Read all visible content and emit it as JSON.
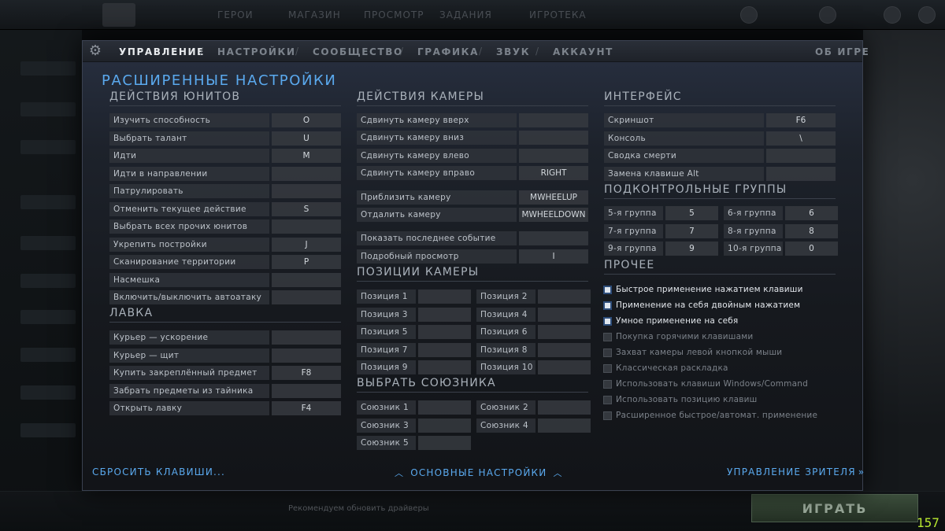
{
  "background": {
    "nav_items": [
      "ГЕРОИ",
      "МАГАЗИН",
      "ПРОСМОТР",
      "ЗАДАНИЯ",
      "ИГРОТЕКА"
    ],
    "play_label": "ИГРАТЬ",
    "chat_text": "Рекомендуем обновить драйверы",
    "fps": "157"
  },
  "tabs": [
    {
      "label": "УПРАВЛЕНИЕ",
      "active": true
    },
    {
      "label": "НАСТРОЙКИ",
      "active": false
    },
    {
      "label": "СООБЩЕСТВО",
      "active": false
    },
    {
      "label": "ГРАФИКА",
      "active": false
    },
    {
      "label": "ЗВУК",
      "active": false
    },
    {
      "label": "АККАУНТ",
      "active": false
    }
  ],
  "tab_separator": "/",
  "about_label": "ОБ ИГРЕ",
  "page_title": "РАСШИРЕННЫЕ НАСТРОЙКИ",
  "unit_actions": {
    "title": "ДЕЙСТВИЯ ЮНИТОВ",
    "rows": [
      {
        "label": "Изучить способность",
        "key": "O"
      },
      {
        "label": "Выбрать талант",
        "key": "U"
      },
      {
        "label": "Идти",
        "key": "M"
      },
      {
        "label": "Идти в направлении",
        "key": ""
      },
      {
        "label": "Патрулировать",
        "key": ""
      },
      {
        "label": "Отменить текущее действие",
        "key": "S"
      },
      {
        "label": "Выбрать всех прочих юнитов",
        "key": ""
      },
      {
        "label": "Укрепить постройки",
        "key": "J"
      },
      {
        "label": "Сканирование территории",
        "key": "P"
      },
      {
        "label": "Насмешка",
        "key": ""
      },
      {
        "label": "Включить/выключить автоатаку",
        "key": ""
      }
    ]
  },
  "shop": {
    "title": "ЛАВКА",
    "rows": [
      {
        "label": "Курьер — ускорение",
        "key": ""
      },
      {
        "label": "Курьер — щит",
        "key": ""
      },
      {
        "label": "Купить закреплённый предмет",
        "key": "F8"
      },
      {
        "label": "Забрать предметы из тайника",
        "key": ""
      },
      {
        "label": "Открыть лавку",
        "key": "F4"
      }
    ]
  },
  "camera_actions": {
    "title": "ДЕЙСТВИЯ КАМЕРЫ",
    "rows": [
      {
        "label": "Сдвинуть камеру вверх",
        "key": ""
      },
      {
        "label": "Сдвинуть камеру вниз",
        "key": ""
      },
      {
        "label": "Сдвинуть камеру влево",
        "key": ""
      },
      {
        "label": "Сдвинуть камеру вправо",
        "key": "RIGHT"
      },
      {
        "label": "Приблизить камеру",
        "key": "MWHEELUP"
      },
      {
        "label": "Отдалить камеру",
        "key": "MWHEELDOWN"
      },
      {
        "label": "Показать последнее событие",
        "key": ""
      },
      {
        "label": "Подробный просмотр",
        "key": "I"
      }
    ]
  },
  "camera_positions": {
    "title": "ПОЗИЦИИ КАМЕРЫ",
    "items": [
      {
        "label": "Позиция 1",
        "key": ""
      },
      {
        "label": "Позиция 2",
        "key": ""
      },
      {
        "label": "Позиция 3",
        "key": ""
      },
      {
        "label": "Позиция 4",
        "key": ""
      },
      {
        "label": "Позиция 5",
        "key": ""
      },
      {
        "label": "Позиция 6",
        "key": ""
      },
      {
        "label": "Позиция 7",
        "key": ""
      },
      {
        "label": "Позиция 8",
        "key": ""
      },
      {
        "label": "Позиция 9",
        "key": ""
      },
      {
        "label": "Позиция 10",
        "key": ""
      }
    ]
  },
  "select_ally": {
    "title": "ВЫБРАТЬ СОЮЗНИКА",
    "items": [
      {
        "label": "Союзник 1",
        "key": ""
      },
      {
        "label": "Союзник 2",
        "key": ""
      },
      {
        "label": "Союзник 3",
        "key": ""
      },
      {
        "label": "Союзник 4",
        "key": ""
      },
      {
        "label": "Союзник 5",
        "key": ""
      }
    ]
  },
  "interface": {
    "title": "ИНТЕРФЕЙС",
    "rows": [
      {
        "label": "Скриншот",
        "key": "F6"
      },
      {
        "label": "Консоль",
        "key": "\\"
      },
      {
        "label": "Сводка смерти",
        "key": ""
      },
      {
        "label": "Замена клавише Alt",
        "key": ""
      }
    ]
  },
  "control_groups": {
    "title": "ПОДКОНТРОЛЬНЫЕ ГРУППЫ",
    "items": [
      {
        "label": "5-я группа",
        "key": "5"
      },
      {
        "label": "6-я группа",
        "key": "6"
      },
      {
        "label": "7-я группа",
        "key": "7"
      },
      {
        "label": "8-я группа",
        "key": "8"
      },
      {
        "label": "9-я группа",
        "key": "9"
      },
      {
        "label": "10-я группа",
        "key": "0"
      }
    ]
  },
  "other": {
    "title": "ПРОЧЕЕ",
    "options": [
      {
        "label": "Быстрое применение нажатием клавиши",
        "checked": true
      },
      {
        "label": "Применение на себя двойным нажатием",
        "checked": true
      },
      {
        "label": "Умное применение на себя",
        "checked": true
      },
      {
        "label": "Покупка горячими клавишами",
        "checked": false
      },
      {
        "label": "Захват камеры левой кнопкой мыши",
        "checked": false
      },
      {
        "label": "Классическая раскладка",
        "checked": false
      },
      {
        "label": "Использовать клавиши Windows/Command",
        "checked": false
      },
      {
        "label": "Использовать позицию клавиш",
        "checked": false
      },
      {
        "label": "Расширенное быстрое/автомат. применение",
        "checked": false
      }
    ]
  },
  "footer": {
    "reset": "СБРОСИТЬ КЛАВИШИ...",
    "basic": "ОСНОВНЫЕ НАСТРОЙКИ",
    "spectator": "УПРАВЛЕНИЕ ЗРИТЕЛЯ"
  },
  "colors": {
    "accent": "#5aa9ee",
    "fps_counter": "#b8e830"
  }
}
